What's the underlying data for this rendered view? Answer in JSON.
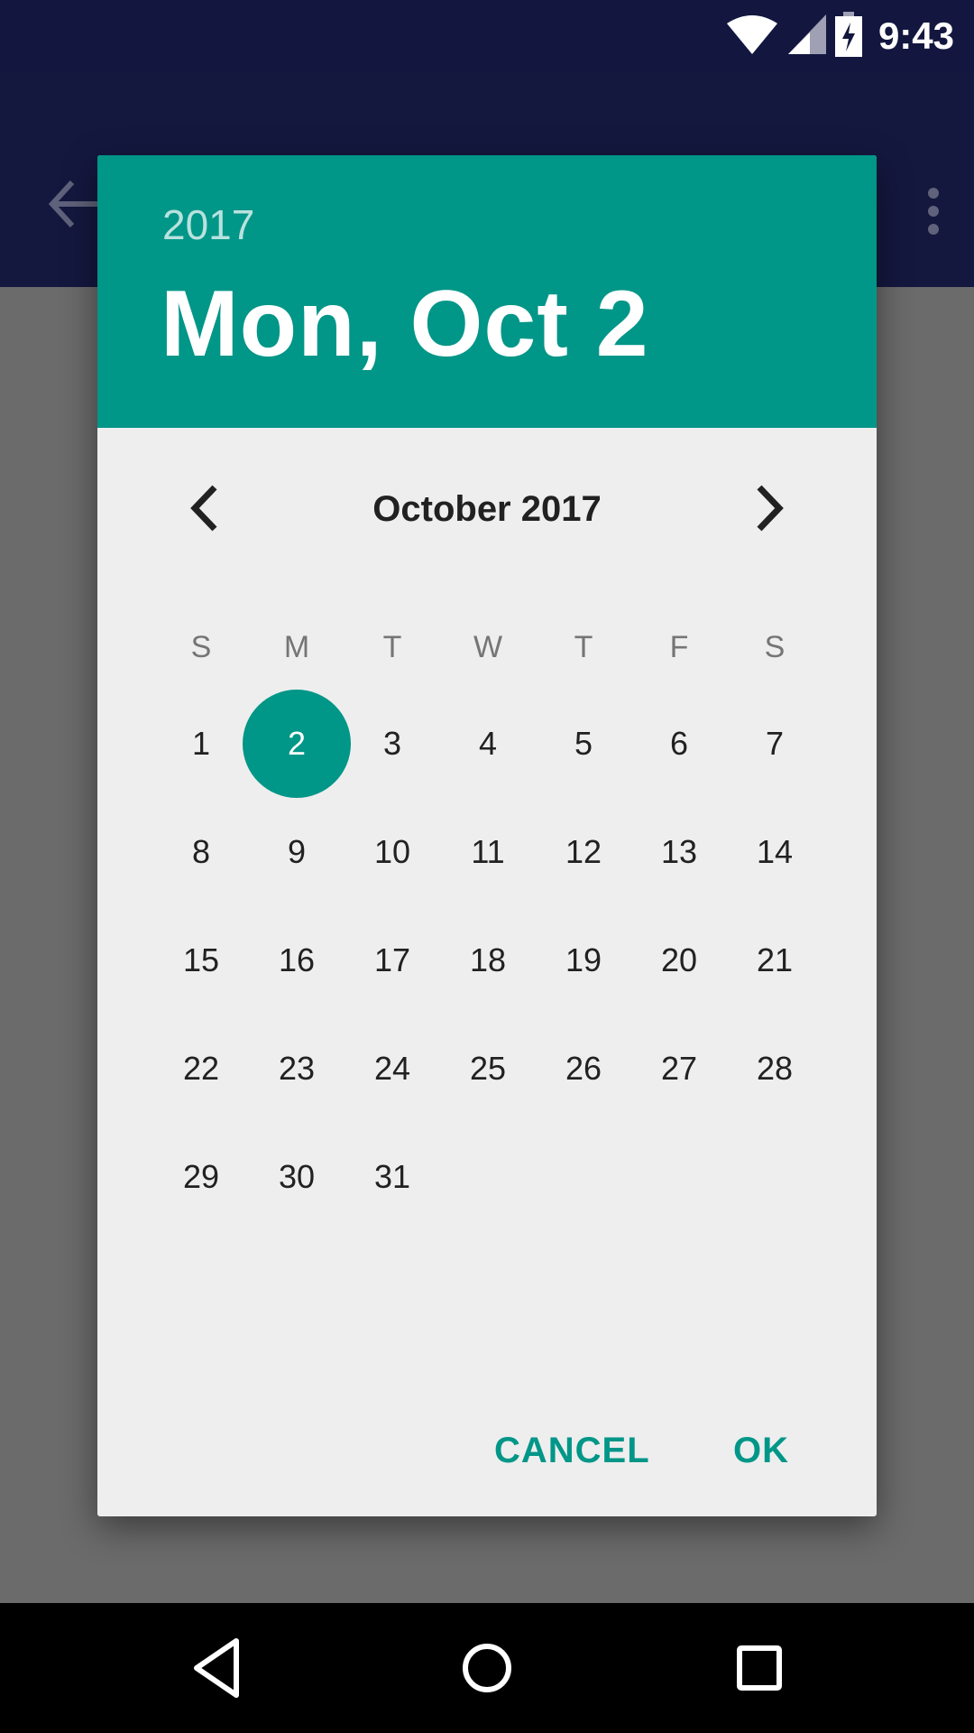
{
  "status_bar": {
    "time": "9:43",
    "icons": [
      "wifi-icon",
      "cellular-signal-icon",
      "battery-charging-icon"
    ]
  },
  "app_bar": {
    "icons": [
      "back-arrow-icon",
      "more-vert-icon"
    ]
  },
  "dialog": {
    "header": {
      "year": "2017",
      "date": "Mon, Oct 2"
    },
    "month_title": "October 2017",
    "weekdays": [
      "S",
      "M",
      "T",
      "W",
      "T",
      "F",
      "S"
    ],
    "weeks": [
      [
        "1",
        "2",
        "3",
        "4",
        "5",
        "6",
        "7"
      ],
      [
        "8",
        "9",
        "10",
        "11",
        "12",
        "13",
        "14"
      ],
      [
        "15",
        "16",
        "17",
        "18",
        "19",
        "20",
        "21"
      ],
      [
        "22",
        "23",
        "24",
        "25",
        "26",
        "27",
        "28"
      ],
      [
        "29",
        "30",
        "31",
        "",
        "",
        "",
        ""
      ]
    ],
    "selected_day": "2",
    "buttons": {
      "cancel": "CANCEL",
      "ok": "OK"
    }
  },
  "nav_bar": {
    "icons": [
      "back-triangle-icon",
      "home-circle-icon",
      "recents-square-icon"
    ]
  },
  "colors": {
    "accent": "#009688",
    "status_bar": "#13173f",
    "scrim": "#6b6b6b",
    "dialog_bg": "#eeeeee"
  }
}
